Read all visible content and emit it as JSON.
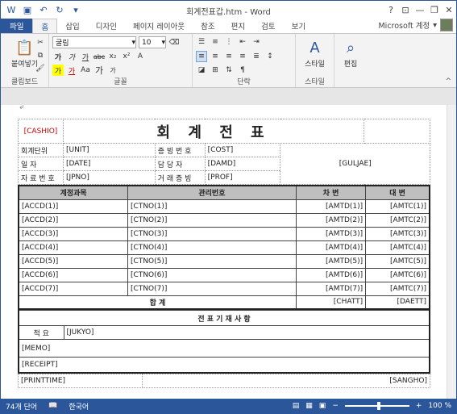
{
  "window": {
    "title": "회계전표갑.htm - Word",
    "help": "?",
    "minimize": "—",
    "restore": "❐",
    "close": "✕"
  },
  "tabs": [
    {
      "label": "파일"
    },
    {
      "label": "홈"
    },
    {
      "label": "삽입"
    },
    {
      "label": "디자인"
    },
    {
      "label": "페이지 레이아웃"
    },
    {
      "label": "참조"
    },
    {
      "label": "편지"
    },
    {
      "label": "검토"
    },
    {
      "label": "보기"
    }
  ],
  "account": {
    "label": "Microsoft 계정"
  },
  "ribbon": {
    "clipboard": {
      "label": "클립보드",
      "paste": "붙여넣기"
    },
    "font": {
      "label": "글꼴",
      "name": "굴림",
      "size": "10",
      "bold": "가",
      "italic": "가",
      "underline": "가",
      "strike": "abc",
      "sub": "x₂",
      "sup": "x²",
      "grow": "가",
      "shrink": "가",
      "case": "Aa",
      "highlight": "가",
      "color": "가"
    },
    "paragraph": {
      "label": "단락"
    },
    "style": {
      "label": "스타일",
      "button": "스타일"
    },
    "edit": {
      "button": "편집"
    }
  },
  "form": {
    "cashio": "[CASHIO]",
    "title": "회 계 전 표",
    "rows": [
      {
        "l1": "회계단위",
        "v1": "[UNIT]",
        "l2": "증 빙 번 호",
        "v2": "[COST]"
      },
      {
        "l1": "일       자",
        "v1": "[DATE]",
        "l2": "담   당   자",
        "v2": "[DAMD]"
      },
      {
        "l1": "자 료 번 호",
        "v1": "[JPNO]",
        "l2": "거 래 증 빙",
        "v2": "[PROF]"
      }
    ],
    "guljae": "[GULJAE]",
    "headers": {
      "acct": "계정과목",
      "mgmt": "관리번호",
      "debit": "차      변",
      "credit": "대      변"
    },
    "lines": [
      {
        "acct": "[ACCD(1)]",
        "mgmt": "[CTNO(1)]",
        "debit": "[AMTD(1)]",
        "credit": "[AMTC(1)]"
      },
      {
        "acct": "[ACCD(2)]",
        "mgmt": "[CTNO(2)]",
        "debit": "[AMTD(2)]",
        "credit": "[AMTC(2)]"
      },
      {
        "acct": "[ACCD(3)]",
        "mgmt": "[CTNO(3)]",
        "debit": "[AMTD(3)]",
        "credit": "[AMTC(3)]"
      },
      {
        "acct": "[ACCD(4)]",
        "mgmt": "[CTNO(4)]",
        "debit": "[AMTD(4)]",
        "credit": "[AMTC(4)]"
      },
      {
        "acct": "[ACCD(5)]",
        "mgmt": "[CTNO(5)]",
        "debit": "[AMTD(5)]",
        "credit": "[AMTC(5)]"
      },
      {
        "acct": "[ACCD(6)]",
        "mgmt": "[CTNO(6)]",
        "debit": "[AMTD(6)]",
        "credit": "[AMTC(6)]"
      },
      {
        "acct": "[ACCD(7)]",
        "mgmt": "[CTNO(7)]",
        "debit": "[AMTD(7)]",
        "credit": "[AMTC(7)]"
      }
    ],
    "total": {
      "label": "합          계",
      "debit": "[CHATT]",
      "credit": "[DAETT]"
    },
    "notes_header": "전 표 기 재 사 항",
    "summary_label": "적     요",
    "summary": "[JUKYO]",
    "memo": "[MEMO]",
    "receipt": "[RECEIPT]",
    "printtime": "[PRINTTIME]",
    "sangho": "[SANGHO]"
  },
  "status": {
    "words": "74개 단어",
    "lang": "한국어",
    "zoom": "100 %",
    "zoom_fraction": 0.5
  },
  "colors": {
    "accent": "#2b579a",
    "red_label": "#cc0000"
  }
}
